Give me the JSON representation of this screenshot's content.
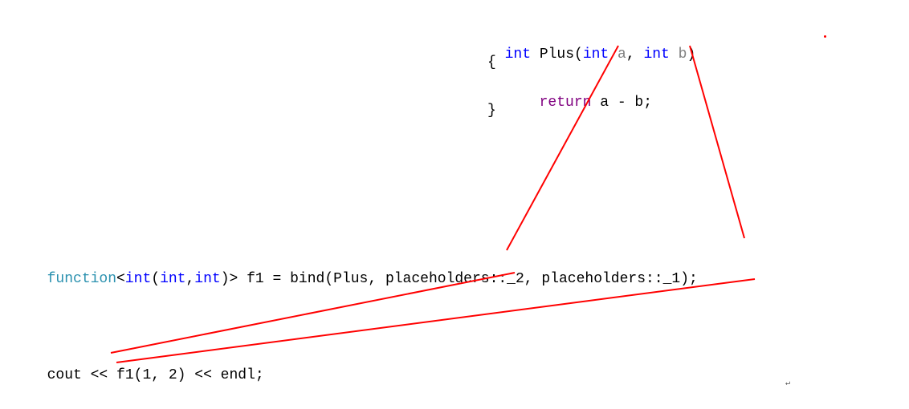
{
  "func_def": {
    "line1": {
      "int1": "int",
      "name": " Plus(",
      "int2": "int",
      "a": " a",
      "comma": ", ",
      "int3": "int",
      "b": " b",
      "close": ")"
    },
    "line2": "{",
    "line3": {
      "return": "return",
      "expr": " a - b;"
    },
    "line4": "}"
  },
  "bind_line": {
    "function_kw": "function",
    "lt": "<",
    "int1": "int",
    "paren_open": "(",
    "int2": "int",
    "comma1": ",",
    "int3": "int",
    "paren_close_gt": ")>",
    "f1": " f1 ",
    "eq": "=",
    "bind": " bind",
    "args": "(Plus, placeholders::_2, placeholders::_1);"
  },
  "cout_line": {
    "cout": "cout ",
    "op1": "<<",
    "f1call": " f1(1, 2) ",
    "op2": "<<",
    "endl": " endl;"
  }
}
